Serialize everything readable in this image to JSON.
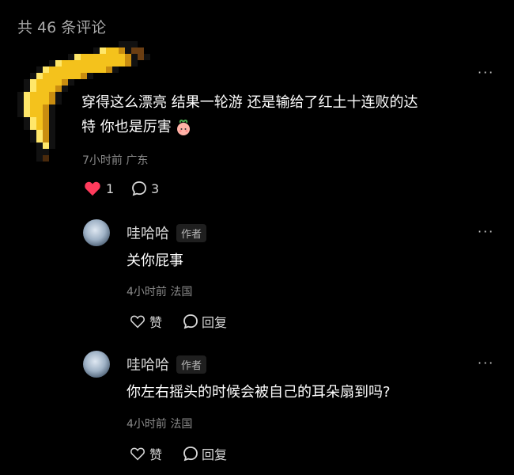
{
  "header": {
    "comment_count_label": "共 46 条评论"
  },
  "comments": [
    {
      "text_line1": "穿得这么漂亮 结果一轮游 还是输给了红土十连败的达",
      "text_line2": "特 你也是厉害",
      "emoji": "peach-emoji",
      "meta": "7小时前 广东",
      "likes": "1",
      "replies": "3",
      "like_color": "#ff3b5c",
      "more_label": "···"
    }
  ],
  "replies": [
    {
      "username": "哇哈哈",
      "badge": "作者",
      "text": "关你屁事",
      "meta": "4小时前 法国",
      "like_label": "赞",
      "reply_label": "回复",
      "more_label": "···"
    },
    {
      "username": "哇哈哈",
      "badge": "作者",
      "text": "你左右摇头的时候会被自己的耳朵扇到吗?",
      "meta": "4小时前 法国",
      "like_label": "赞",
      "reply_label": "回复",
      "more_label": "···"
    }
  ]
}
